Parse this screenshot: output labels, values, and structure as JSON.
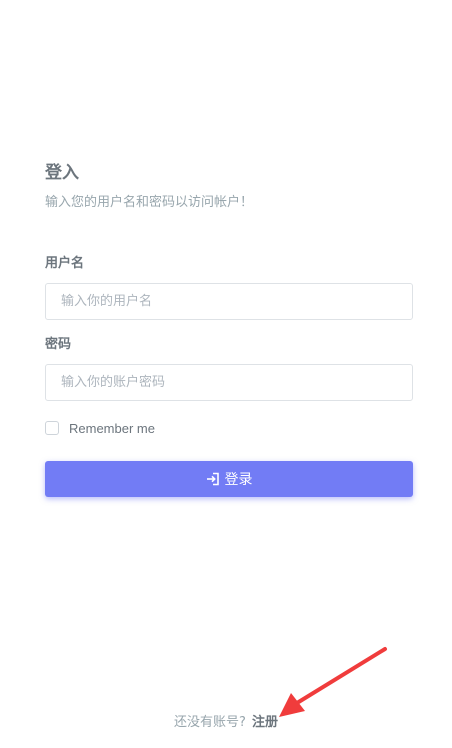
{
  "login": {
    "title": "登入",
    "subtitle": "输入您的用户名和密码以访问帐户！",
    "username_label": "用户名",
    "username_placeholder": "输入你的用户名",
    "password_label": "密码",
    "password_placeholder": "输入你的账户密码",
    "remember_label": "Remember me",
    "submit_label": "登录",
    "submit_icon": "login-icon"
  },
  "footer": {
    "prompt": "还没有账号?",
    "register_label": "注册"
  },
  "colors": {
    "accent": "#727cf5",
    "annotation_arrow": "#f03c3c"
  }
}
